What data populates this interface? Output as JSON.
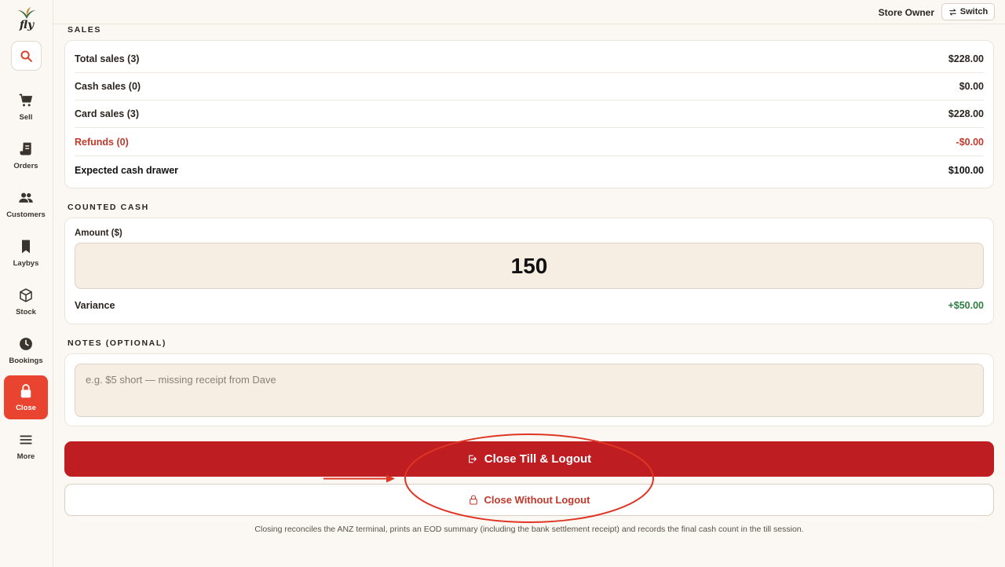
{
  "sidebar": {
    "logo_text": "fly",
    "items": [
      {
        "label": "Sell",
        "icon": "cart-icon"
      },
      {
        "label": "Orders",
        "icon": "receipt-icon"
      },
      {
        "label": "Customers",
        "icon": "users-icon"
      },
      {
        "label": "Laybys",
        "icon": "bookmark-icon"
      },
      {
        "label": "Stock",
        "icon": "box-icon"
      },
      {
        "label": "Bookings",
        "icon": "clock-icon"
      },
      {
        "label": "Close",
        "icon": "lock-icon",
        "active": true
      },
      {
        "label": "More",
        "icon": "menu-icon"
      }
    ]
  },
  "header": {
    "role": "Store Owner",
    "switch_label": "Switch"
  },
  "sales": {
    "title": "SALES",
    "rows": [
      {
        "label": "Total sales (3)",
        "value": "$228.00"
      },
      {
        "label": "Cash sales (0)",
        "value": "$0.00"
      },
      {
        "label": "Card sales (3)",
        "value": "$228.00"
      },
      {
        "label": "Refunds (0)",
        "value": "-$0.00"
      },
      {
        "label": "Expected cash drawer",
        "value": "$100.00"
      }
    ]
  },
  "counted_cash": {
    "title": "COUNTED CASH",
    "amount_label": "Amount ($)",
    "amount_value": "150",
    "variance_label": "Variance",
    "variance_value": "+$50.00"
  },
  "notes": {
    "title": "NOTES (OPTIONAL)",
    "placeholder": "e.g. $5 short — missing receipt from Dave"
  },
  "actions": {
    "close_logout_label": "Close Till & Logout",
    "close_no_logout_label": "Close Without Logout"
  },
  "footnote": "Closing reconciles the ANZ terminal, prints an EOD summary (including the bank settlement receipt) and records the final cash count in the till session.",
  "colors": {
    "primary": "#be1e22",
    "active_nav": "#e8442f",
    "positive": "#2e7d43",
    "refund": "#c0392b"
  }
}
